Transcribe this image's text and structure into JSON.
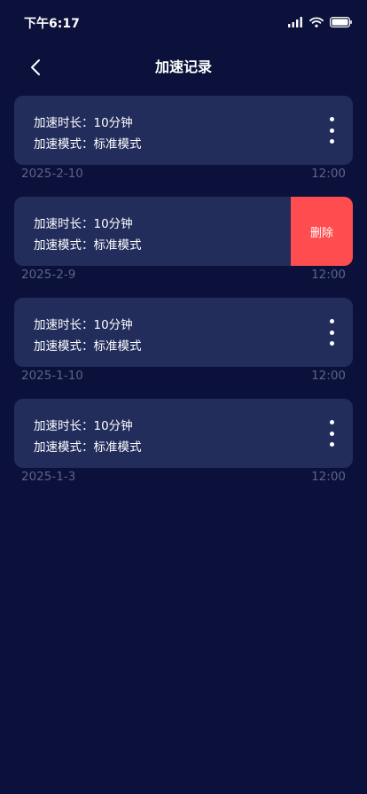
{
  "status_bar": {
    "time": "下午6:17"
  },
  "header": {
    "title": "加速记录"
  },
  "records": [
    {
      "duration": "加速时长：10分钟",
      "mode": "加速模式：标准模式",
      "date": "2025-2-10",
      "time": "12:00"
    },
    {
      "duration": "加速时长：10分钟",
      "mode": "加速模式：标准模式",
      "date": "2025-2-9",
      "time": "12:00",
      "delete_label": "删除"
    },
    {
      "duration": "加速时长：10分钟",
      "mode": "加速模式：标准模式",
      "date": "2025-1-10",
      "time": "12:00"
    },
    {
      "duration": "加速时长：10分钟",
      "mode": "加速模式：标准模式",
      "date": "2025-1-3",
      "time": "12:00"
    }
  ],
  "colors": {
    "background": "#0b113a",
    "card": "#222d5c",
    "muted_text": "#5b6489",
    "delete": "#ff4d4f"
  }
}
